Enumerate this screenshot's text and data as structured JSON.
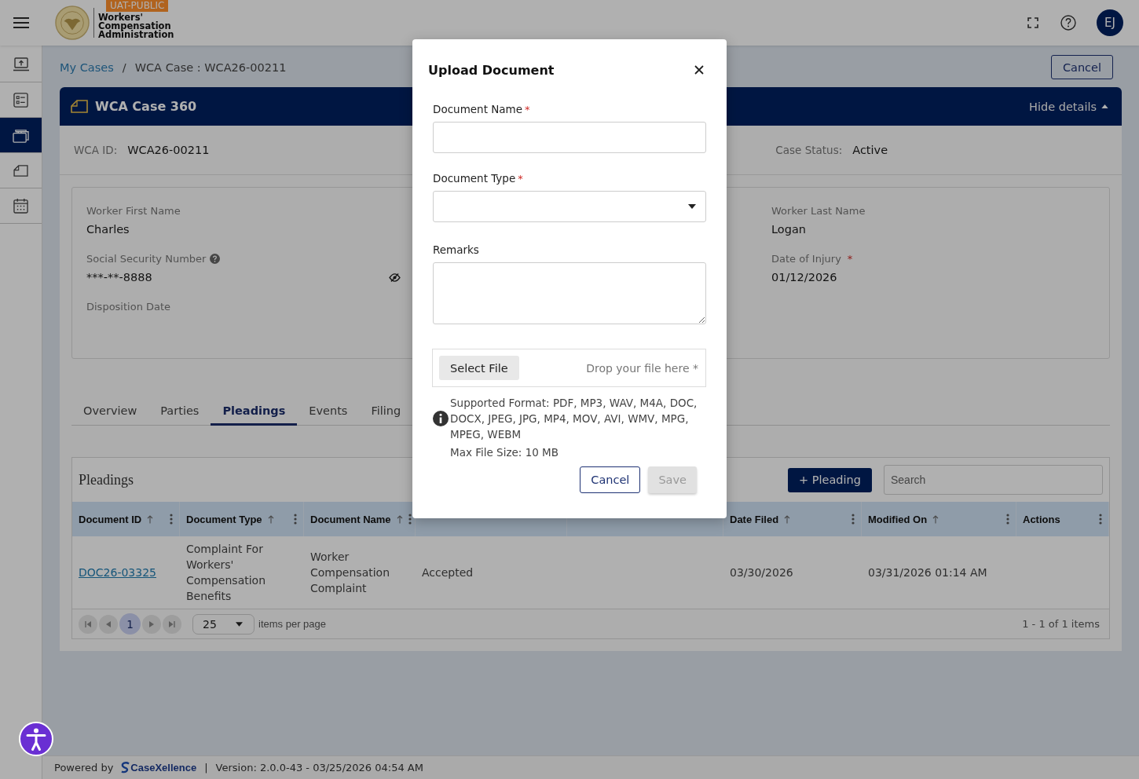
{
  "header": {
    "environment_badge": "UAT-PUBLIC",
    "logo_text": "Workers' Compensation Administration",
    "avatar_initials": "EJ"
  },
  "sidebar": {
    "items": [
      {
        "selected": false
      },
      {
        "selected": false
      },
      {
        "selected": true
      },
      {
        "selected": false
      },
      {
        "selected": false
      }
    ]
  },
  "breadcrumb": [
    {
      "label": "My Cases",
      "kind": "link"
    },
    {
      "label": "/",
      "kind": "separator"
    },
    {
      "label": "WCA Case : WCA26-00211",
      "kind": "current"
    }
  ],
  "cancel_button": "Cancel",
  "case": {
    "title": "WCA Case 360",
    "toggle_label": "Hide details",
    "expanded": true,
    "summary": [
      {
        "label": "WCA ID:",
        "value": "WCA26-00211"
      },
      {
        "label": "Case Status:",
        "value": "Active"
      }
    ],
    "details_left": [
      {
        "label": "Worker First Name",
        "value": "Charles"
      },
      {
        "label": "Social Security Number",
        "help": true,
        "value": "***-**-8888",
        "masked": true
      },
      {
        "label": "Disposition Date"
      }
    ],
    "details_right": [
      {
        "label": "Worker Last Name",
        "value": "Logan"
      },
      {
        "label": "Date of Injury",
        "required_mark": "*",
        "value": "01/12/2026"
      }
    ]
  },
  "tabs": [
    {
      "label": "Overview",
      "selected": false
    },
    {
      "label": "Parties",
      "selected": false
    },
    {
      "label": "Pleadings",
      "selected": true
    },
    {
      "label": "Events",
      "selected": false
    },
    {
      "label": "Filing",
      "selected": false
    }
  ],
  "pleadings": {
    "title": "Pleadings",
    "add_button": "+ Pleading",
    "search": {
      "placeholder": "Search"
    },
    "columns": [
      {
        "kind": "heading",
        "label": "Document ID",
        "sortable": true
      },
      {
        "kind": "heading",
        "label": "Document Type",
        "sortable": true
      },
      {
        "kind": "heading",
        "label": "Document Name",
        "sortable": true
      },
      {
        "kind": "covered"
      },
      {
        "kind": "covered"
      },
      {
        "kind": "heading",
        "label": "Date Filed",
        "sortable": true
      },
      {
        "kind": "heading",
        "label": "Modified On",
        "sortable": true
      },
      {
        "kind": "heading",
        "label": "Actions",
        "sortable": false
      }
    ],
    "rows": [
      {
        "document_id": "DOC26-03325",
        "document_type": "Complaint For Workers' Compensation Benefits",
        "document_name": "Worker Compensation Complaint",
        "column_4": "Accepted",
        "date_filed": "03/30/2026",
        "modified_on": "03/31/2026 01:14 AM"
      }
    ],
    "pager": {
      "pages": [
        {
          "label": "1",
          "selected": true
        }
      ],
      "page_size": "25",
      "page_size_label": "items per page",
      "summary": "1 - 1 of 1 items"
    }
  },
  "footer": {
    "powered_by": "Powered by",
    "brand": "CaseXellence",
    "separator": "|",
    "version": "Version: 2.0.0-43 - 03/25/2026 04:54 AM"
  },
  "modal": {
    "title": "Upload Document",
    "fields": [
      {
        "kind": "text",
        "label": "Document Name",
        "required_mark": "*"
      },
      {
        "kind": "select",
        "label": "Document Type",
        "required_mark": "*"
      },
      {
        "kind": "textarea",
        "label": "Remarks"
      }
    ],
    "file_picker": {
      "button": "Select File",
      "drop_hint": "Drop your file here *"
    },
    "supported_formats": "Supported Format: PDF, MP3, WAV, M4A, DOC, DOCX, JPEG, JPG, MP4, MOV, AVI, WMV, MPG, MPEG, WEBM",
    "max_size": "Max File Size: 10 MB",
    "buttons": [
      {
        "label": "Cancel",
        "disabled": false
      },
      {
        "label": "Save",
        "disabled": true
      }
    ]
  }
}
